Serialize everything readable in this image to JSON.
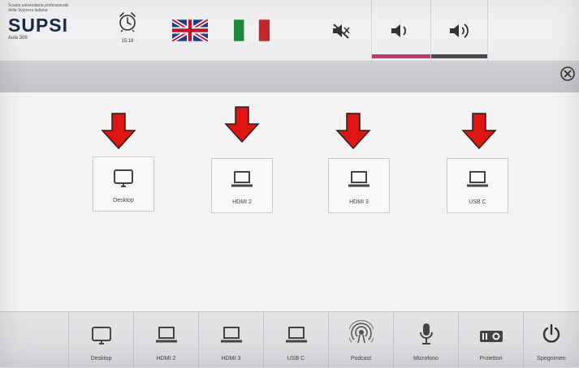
{
  "topbar": {
    "logo": {
      "line1": "Scuola universitaria professionale",
      "line2": "della Svizzera italiana",
      "brand": "SUPSI",
      "room": "Aula 309"
    },
    "clock": {
      "icon": "alarm-clock-icon",
      "time": "15:18"
    },
    "languages": [
      {
        "name": "flag-uk-icon"
      },
      {
        "name": "flag-italy-icon"
      }
    ],
    "volume": {
      "mute_icon": "speaker-mute-icon",
      "down_icon": "volume-down-icon",
      "up_icon": "volume-up-icon",
      "active_color": "#c8356a",
      "inactive_color": "#4a4a4c"
    }
  },
  "header": {
    "close_icon": "close-circle-icon"
  },
  "sources": [
    {
      "label": "Desktop",
      "icon": "monitor-icon"
    },
    {
      "label": "HDMI 2",
      "icon": "laptop-icon"
    },
    {
      "label": "HDMI 3",
      "icon": "laptop-icon"
    },
    {
      "label": "USB C",
      "icon": "laptop-icon"
    }
  ],
  "annotation": {
    "arrow_color": "#e0140f",
    "arrow_icon": "red-down-arrow"
  },
  "bottombar": {
    "buttons": [
      {
        "label": "Desktop",
        "icon": "monitor-icon"
      },
      {
        "label": "HDMI 2",
        "icon": "laptop-icon"
      },
      {
        "label": "HDMI 3",
        "icon": "laptop-icon"
      },
      {
        "label": "USB C",
        "icon": "laptop-icon"
      },
      {
        "label": "Podcast",
        "icon": "podcast-icon"
      },
      {
        "label": "Microfono",
        "icon": "microphone-icon"
      },
      {
        "label": "Proiettori",
        "icon": "projector-icon"
      },
      {
        "label": "Spegnimen",
        "icon": "power-icon"
      }
    ]
  }
}
